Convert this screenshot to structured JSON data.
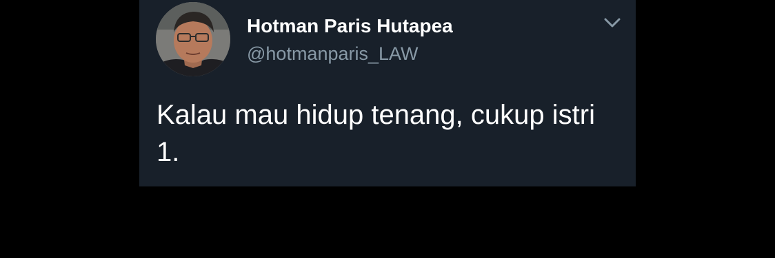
{
  "tweet": {
    "author_name": "Hotman Paris Hutapea",
    "author_handle": "@hotmanparis_LAW",
    "text": "Kalau mau hidup tenang, cukup istri 1.",
    "menu_icon": "chevron-down-icon",
    "avatar_icon": "profile-photo"
  },
  "colors": {
    "page_background": "#000000",
    "card_background": "#18202a",
    "name_color": "#ffffff",
    "handle_color": "#8899a6",
    "text_color": "#ffffff",
    "caret_color": "#8899a6"
  }
}
